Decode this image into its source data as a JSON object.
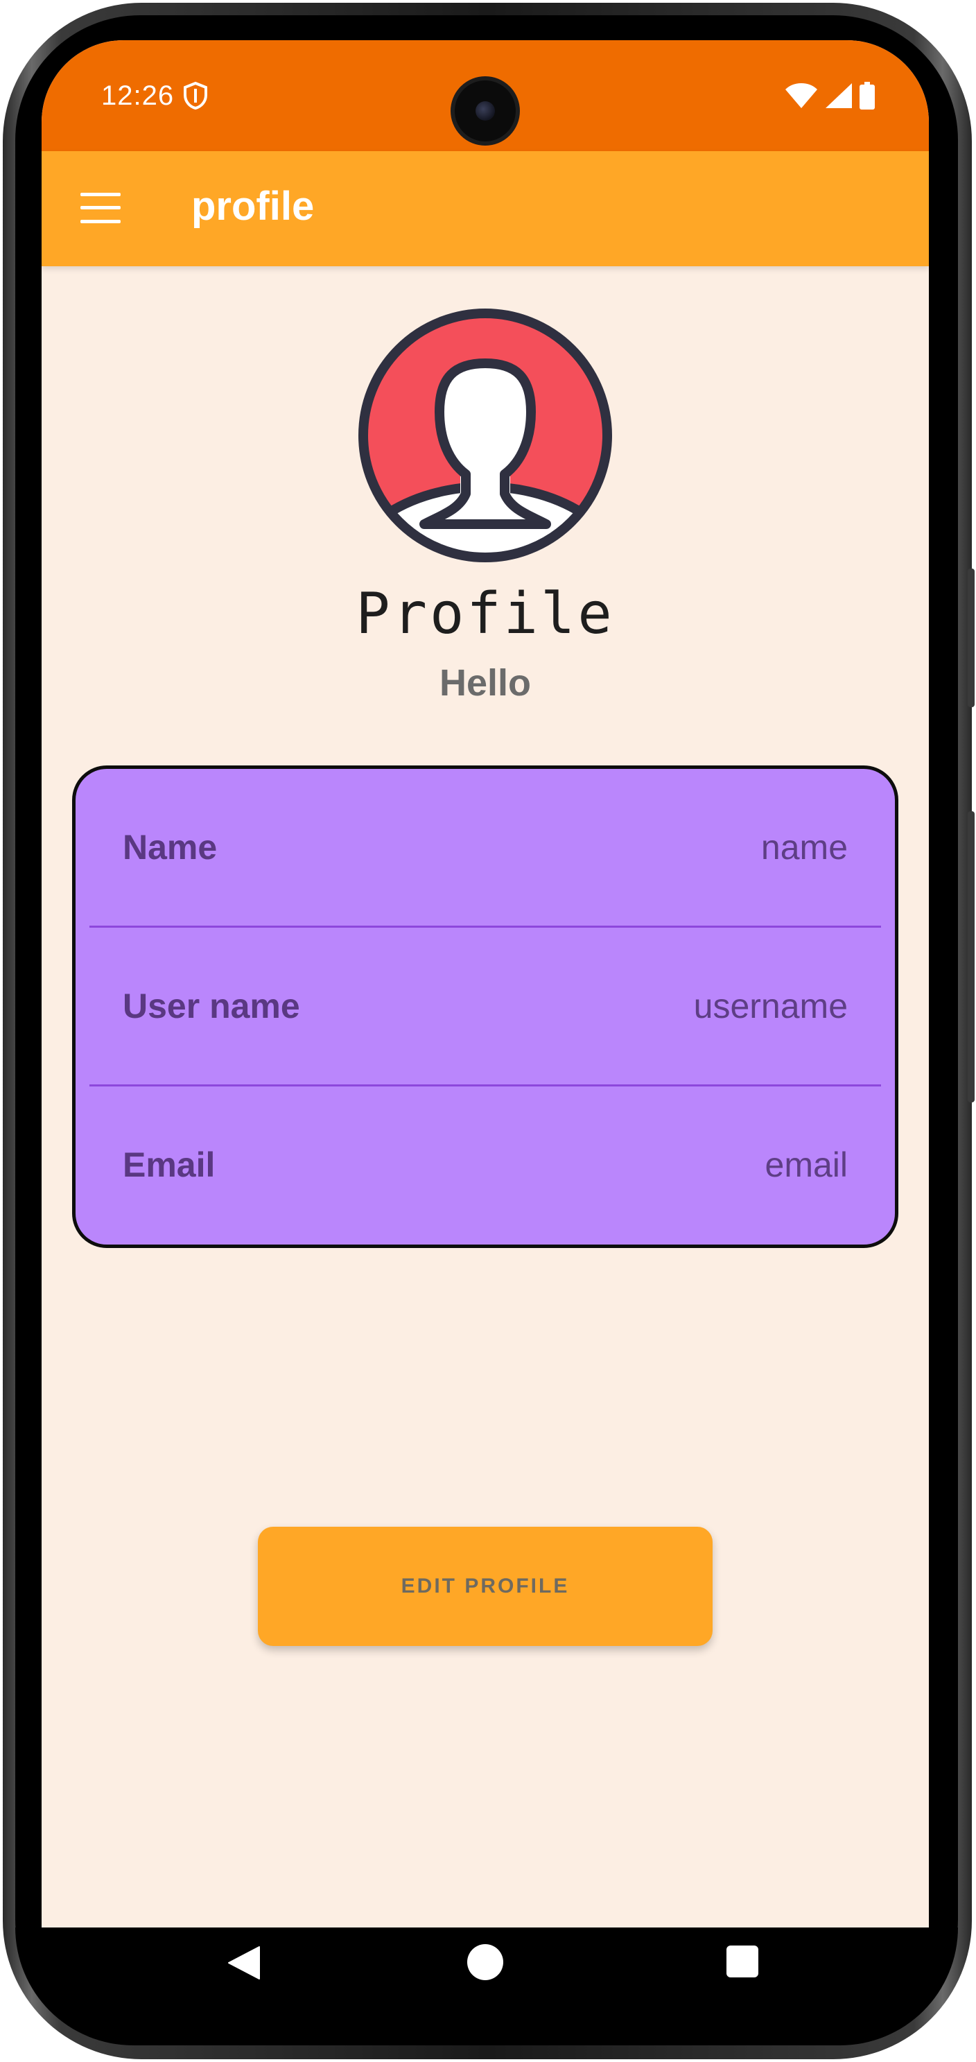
{
  "status_bar": {
    "time": "12:26",
    "background": "#EF6C00"
  },
  "app_bar": {
    "title": "profile",
    "menu_icon": "hamburger-menu-icon",
    "background": "#FFA726"
  },
  "profile": {
    "avatar_icon": "user-avatar-icon",
    "heading": "Profile",
    "subheading": "Hello"
  },
  "info_card": {
    "background": "#BA86FC",
    "rows": [
      {
        "label": "Name",
        "value": "name"
      },
      {
        "label": "User name",
        "value": "username"
      },
      {
        "label": "Email",
        "value": "email"
      }
    ]
  },
  "edit_button": {
    "label": "EDIT PROFILE"
  },
  "navigation": {
    "icons": [
      "nav-back-icon",
      "nav-home-icon",
      "nav-recents-icon"
    ]
  },
  "colors": {
    "screen_background": "#FCEEE3",
    "accent_orange": "#FFA726",
    "status_orange": "#EF6C00",
    "card_purple": "#BA86FC",
    "avatar_red": "#F44F5A"
  }
}
